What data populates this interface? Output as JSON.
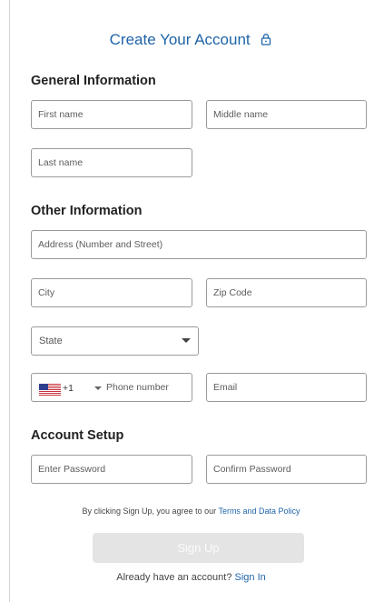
{
  "form": {
    "title": "Create Your Account",
    "title_color": "#1f64a8",
    "title_icon": "lock-icon"
  },
  "general": {
    "heading": "General Information",
    "first_name_placeholder": "First name",
    "middle_name_placeholder": "Middle name",
    "last_name_placeholder": "Last name"
  },
  "other": {
    "heading": "Other Information",
    "address_placeholder": "Address (Number and Street)",
    "city_placeholder": "City",
    "zip_placeholder": "Zip Code",
    "state_selected": "State",
    "phone_country_flag": "us-flag-icon",
    "phone_dial_code": "+1",
    "phone_placeholder": "Phone number",
    "email_placeholder": "Email"
  },
  "account": {
    "heading": "Account Setup",
    "password_placeholder": "Enter Password",
    "confirm_password_placeholder": "Confirm Password"
  },
  "footer": {
    "terms_prefix": "By clicking Sign Up, you agree to our ",
    "terms_link": "Terms and Data Policy",
    "signup_label": "Sign Up",
    "signin_prefix": "Already have an account? ",
    "signin_link": "Sign In",
    "link_color": "#1f64a8",
    "button_color": "#e4e4e4"
  }
}
